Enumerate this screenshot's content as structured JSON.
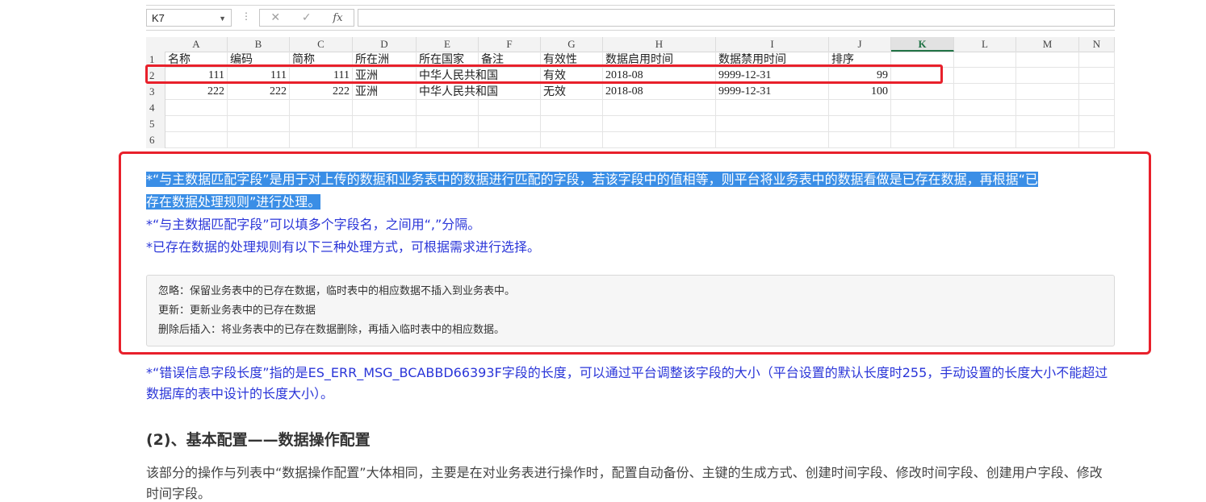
{
  "excel": {
    "name_box": "K7",
    "fx_label": "fx",
    "columns": [
      "A",
      "B",
      "C",
      "D",
      "E",
      "F",
      "G",
      "H",
      "I",
      "J",
      "K",
      "L",
      "M",
      "N"
    ],
    "active_column": "K",
    "rows": [
      {
        "num": "1",
        "cells": [
          "名称",
          "编码",
          "简称",
          "所在洲",
          "所在国家",
          "备注",
          "有效性",
          "数据启用时间",
          "数据禁用时间",
          "排序"
        ]
      },
      {
        "num": "2",
        "cells": [
          "111",
          "111",
          "111",
          "亚洲",
          "中华人民共和国",
          "",
          "有效",
          "2018-08",
          "9999-12-31",
          "99"
        ]
      },
      {
        "num": "3",
        "cells": [
          "222",
          "222",
          "222",
          "亚洲",
          "中华人民共和国",
          "",
          "无效",
          "2018-08",
          "9999-12-31",
          "100"
        ]
      },
      {
        "num": "4",
        "cells": []
      },
      {
        "num": "5",
        "cells": []
      },
      {
        "num": "6",
        "cells": []
      }
    ]
  },
  "notes": {
    "line1_highlight_a": "*“与主数据匹配字段”是用于对上传的数据和业务表中的数据进行匹配的字段，若该字段中的值相等，则平台将业务表中的数据看做是已存在数据，再根据“已",
    "line1_highlight_b": "存在数据处理规则”进行处理。",
    "line2": "*“与主数据匹配字段”可以填多个字段名，之间用“,”分隔。",
    "line3": "*已存在数据的处理规则有以下三种处理方式，可根据需求进行选择。",
    "rules": [
      "忽略：保留业务表中的已存在数据，临时表中的相应数据不插入到业务表中。",
      "更新：更新业务表中的已存在数据",
      "删除后插入：将业务表中的已存在数据删除，再插入临时表中的相应数据。"
    ]
  },
  "after_note": "*“错误信息字段长度”指的是ES_ERR_MSG_BCABBD66393F字段的长度，可以通过平台调整该字段的大小（平台设置的默认长度时255，手动设置的长度大小不能超过数据库的表中设计的长度大小）。",
  "section": {
    "heading": "(2)、基本配置——数据操作配置",
    "body": "该部分的操作与列表中“数据操作配置”大体相同，主要是在对业务表进行操作时，配置自动备份、主键的生成方式、创建时间字段、修改时间字段、创建用户字段、修改时间字段。"
  }
}
